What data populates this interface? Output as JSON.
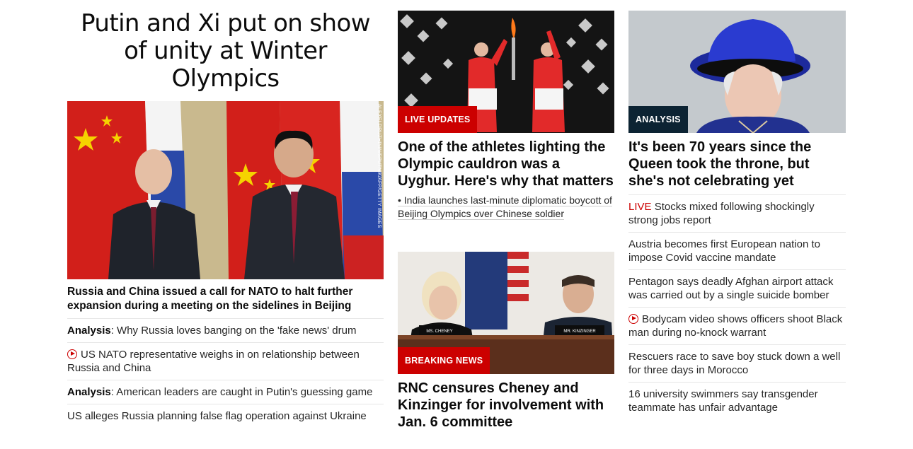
{
  "left": {
    "headline": "Putin and Xi put on show of unity at Winter Olympics",
    "photo_credit": "ALEXEI DRUZHININ/SPUTNIK/AFP/GETTY IMAGES",
    "lead_sub": "Russia and China issued a call for NATO to halt further expansion during a meeting on the sidelines in Beijing",
    "items": [
      {
        "prefix": "Analysis",
        "text": ": Why Russia loves banging on the 'fake news' drum"
      },
      {
        "video": true,
        "text": "US NATO representative weighs in on relationship between Russia and China"
      },
      {
        "prefix": "Analysis",
        "text": ": American leaders are caught in Putin's guessing game"
      },
      {
        "text": "US alleges Russia planning false flag operation against Ukraine"
      }
    ]
  },
  "middle": {
    "card1": {
      "badge": "LIVE UPDATES",
      "headline": "One of the athletes lighting the Olympic cauldron was a Uyghur. Here's why that matters",
      "bullet": "• India launches last-minute diplomatic boycott of Beijing Olympics over Chinese soldier"
    },
    "card2": {
      "badge": "BREAKING NEWS",
      "headline": "RNC censures Cheney and Kinzinger for involvement with Jan. 6 committee",
      "placard_left": "MS. CHENEY",
      "placard_right": "MR. KINZINGER"
    }
  },
  "right": {
    "badge": "ANALYSIS",
    "headline": "It's been 70 years since the Queen took the throne, but she's not celebrating yet",
    "items": [
      {
        "live": "LIVE",
        "text": " Stocks mixed following shockingly strong jobs report"
      },
      {
        "text": "Austria becomes first European nation to impose Covid vaccine mandate"
      },
      {
        "text": "Pentagon says deadly Afghan airport attack was carried out by a single suicide bomber"
      },
      {
        "video": true,
        "text": "Bodycam video shows officers shoot Black man during no-knock warrant"
      },
      {
        "text": "Rescuers race to save boy stuck down a well for three days in Morocco"
      },
      {
        "text": "16 university swimmers say transgender teammate has unfair advantage"
      }
    ]
  },
  "colors": {
    "accent_red": "#cc0000",
    "analysis_badge": "#0c2333"
  }
}
